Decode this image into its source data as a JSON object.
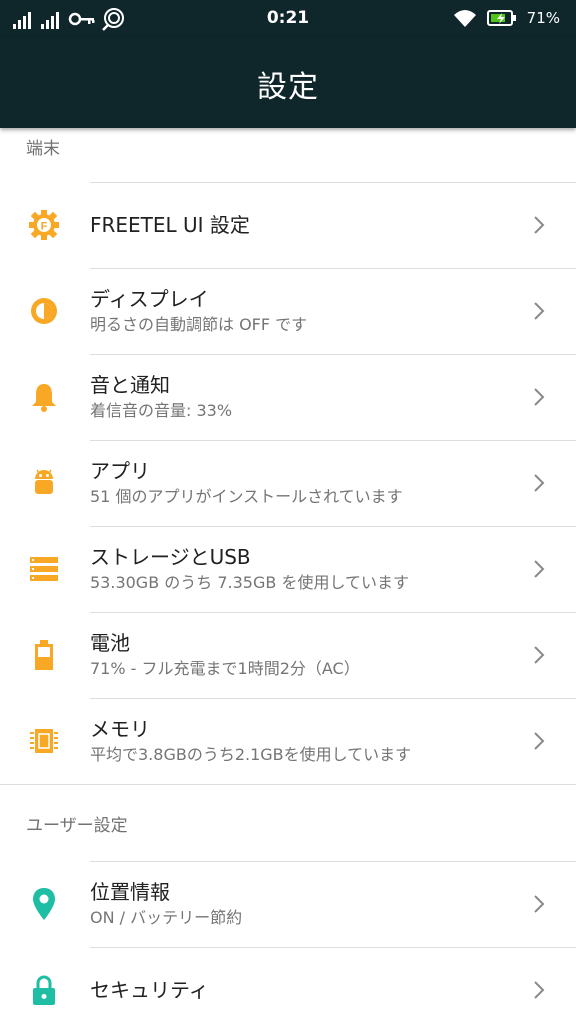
{
  "status_bar": {
    "time": "0:21",
    "battery_percent": "71%",
    "icons": [
      "signal-icon",
      "signal-icon",
      "key-icon",
      "call-icon",
      "wifi-icon",
      "battery-charging-icon"
    ]
  },
  "app_bar": {
    "title": "設定"
  },
  "sections": [
    {
      "header": "端末",
      "items": [
        {
          "label": "FREETEL UI 設定",
          "sub": "",
          "icon": "freetel-gear-icon"
        },
        {
          "label": "ディスプレイ",
          "sub": "明るさの自動調節は OFF です",
          "icon": "brightness-icon"
        },
        {
          "label": "音と通知",
          "sub": "着信音の音量: 33%",
          "icon": "bell-icon"
        },
        {
          "label": "アプリ",
          "sub": "51 個のアプリがインストールされています",
          "icon": "android-icon"
        },
        {
          "label": "ストレージとUSB",
          "sub": "53.30GB のうち 7.35GB を使用しています",
          "icon": "storage-icon"
        },
        {
          "label": "電池",
          "sub": "71% - フル充電まで1時間2分（AC）",
          "icon": "battery-icon"
        },
        {
          "label": "メモリ",
          "sub": "平均で3.8GBのうち2.1GBを使用しています",
          "icon": "memory-icon"
        }
      ]
    },
    {
      "header": "ユーザー設定",
      "items": [
        {
          "label": "位置情報",
          "sub": "ON / バッテリー節約",
          "icon": "location-icon"
        },
        {
          "label": "セキュリティ",
          "sub": "",
          "icon": "lock-icon"
        }
      ]
    }
  ],
  "colors": {
    "app_bar": "#0f262b",
    "accent_orange": "#f9a825",
    "accent_teal": "#1ebea5"
  }
}
